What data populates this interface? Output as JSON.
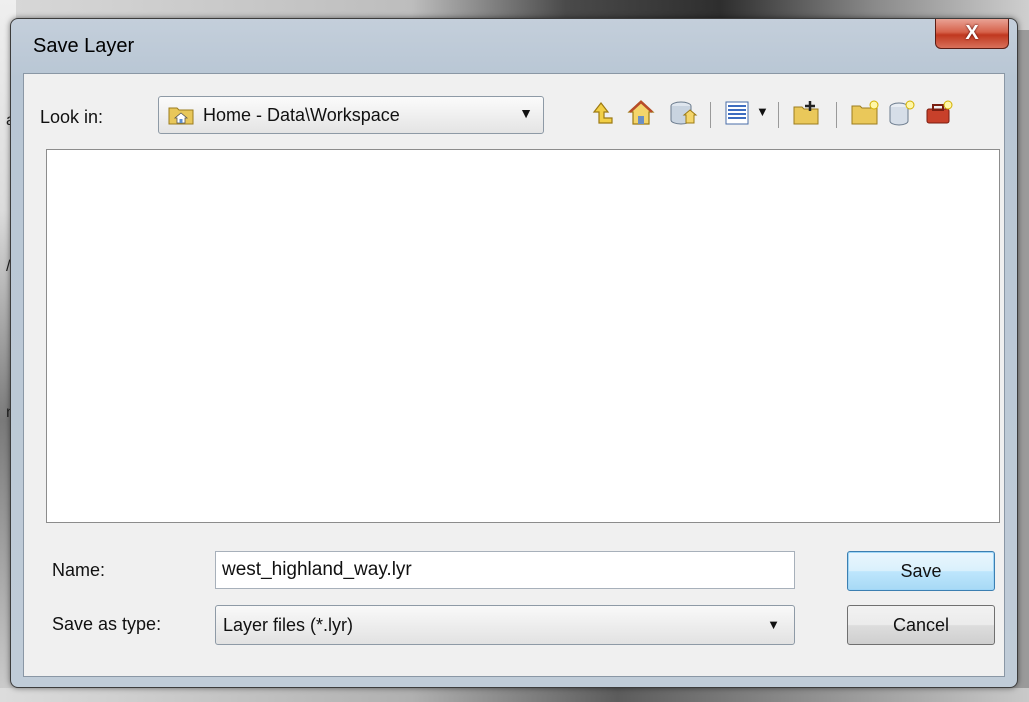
{
  "dialog": {
    "title": "Save Layer",
    "close_label": "X"
  },
  "look_in": {
    "label": "Look in:",
    "value": "Home - Data\\Workspace"
  },
  "toolbar": {
    "icons": [
      "up-one-level-icon",
      "home-icon",
      "database-home-icon",
      "view-menu-icon",
      "view-dropdown-icon",
      "connect-folder-icon",
      "new-folder-icon",
      "new-geodatabase-icon",
      "new-toolbox-icon"
    ]
  },
  "file_list": {
    "items": []
  },
  "name": {
    "label": "Name:",
    "value": "west_highland_way.lyr"
  },
  "save_as_type": {
    "label": "Save as type:",
    "value": "Layer files (*.lyr)"
  },
  "buttons": {
    "save": "Save",
    "cancel": "Cancel"
  },
  "background": {
    "edge_letters": [
      "a",
      "/",
      "n"
    ]
  }
}
